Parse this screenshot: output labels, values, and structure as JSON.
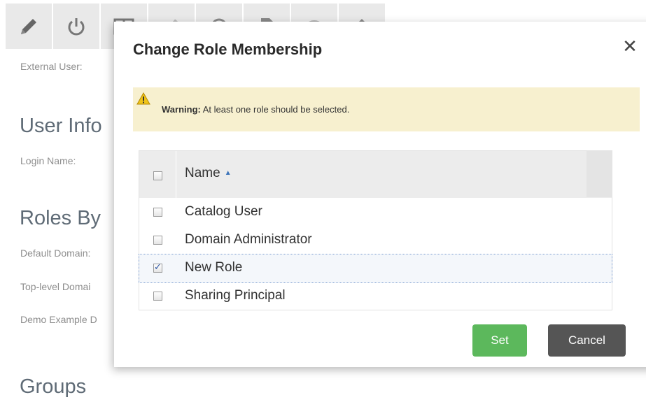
{
  "background": {
    "toolbar_icons": [
      "pencil-icon",
      "power-icon",
      "columns-icon",
      "tag-icon",
      "chat-icon",
      "document-icon",
      "wifi-icon",
      "home-icon"
    ],
    "external_user_label": "External User:",
    "user_info_heading": "User Info",
    "login_name_label": "Login Name:",
    "roles_heading": "Roles By",
    "default_domain_label": "Default Domain:",
    "top_level_domain_label": "Top-level Domai",
    "demo_example_label": "Demo Example D",
    "groups_heading": "Groups"
  },
  "dialog": {
    "title": "Change Role Membership",
    "close_glyph": "✕",
    "warning_strong": "Warning:",
    "warning_text": " At least one role should be selected.",
    "grid": {
      "column_name": "Name",
      "sort_glyph": "▲",
      "rows": [
        {
          "label": "Catalog User",
          "checked": false
        },
        {
          "label": "Domain Administrator",
          "checked": false
        },
        {
          "label": "New Role",
          "checked": true
        },
        {
          "label": "Sharing Principal",
          "checked": false
        }
      ]
    },
    "set_label": "Set",
    "cancel_label": "Cancel",
    "colors": {
      "set": "#5cb85c",
      "cancel": "#555555",
      "warning_bg": "#f7f0cf",
      "sort_arrow": "#3b73b9"
    }
  }
}
